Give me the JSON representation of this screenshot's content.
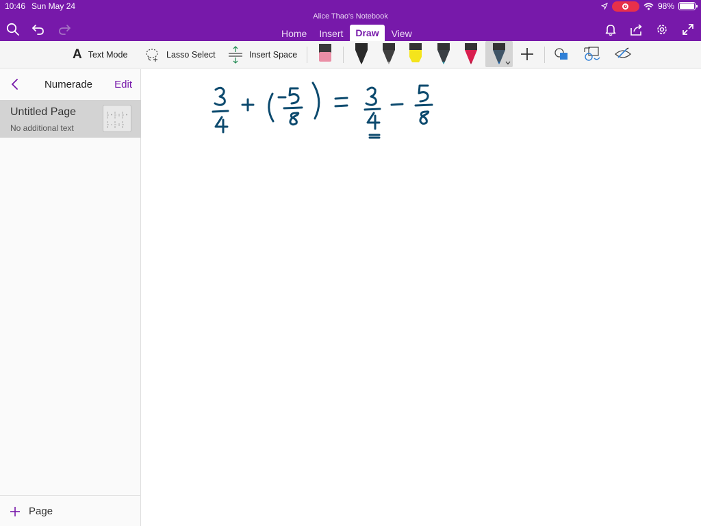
{
  "status_bar": {
    "time": "10:46",
    "date": "Sun May 24",
    "battery": "98%",
    "battery_level": 0.98
  },
  "header": {
    "notebook_title": "Alice Thao's Notebook",
    "tabs": [
      {
        "label": "Home",
        "active": false
      },
      {
        "label": "Insert",
        "active": false
      },
      {
        "label": "Draw",
        "active": true
      },
      {
        "label": "View",
        "active": false
      }
    ],
    "icons": [
      "search-icon",
      "undo-icon",
      "redo-icon",
      "bell-icon",
      "share-icon",
      "gear-icon",
      "fullscreen-icon"
    ]
  },
  "toolbar": {
    "text_mode": "Text Mode",
    "lasso_select": "Lasso Select",
    "insert_space": "Insert Space",
    "pens": [
      {
        "name": "eraser",
        "color": "#ea8fa6"
      },
      {
        "name": "black-pen",
        "color": "#222222"
      },
      {
        "name": "gray-pen",
        "color": "#666666"
      },
      {
        "name": "yellow-highlighter",
        "color": "#f4e41c"
      },
      {
        "name": "teal-pen",
        "color": "#2e8a9a"
      },
      {
        "name": "red-pen",
        "color": "#d81e4e"
      },
      {
        "name": "blue-pen",
        "color": "#1f5f9f",
        "selected": true
      }
    ]
  },
  "sidebar": {
    "back_label": "Numerade",
    "edit_label": "Edit",
    "pages": [
      {
        "title": "Untitled Page",
        "subtitle": "No additional text",
        "selected": true
      }
    ],
    "add_page_label": "Page"
  },
  "colors": {
    "brand_purple": "#7719aa",
    "ink_blue": "#0c4a6e",
    "selected_page_bg": "#d3d3d3"
  }
}
